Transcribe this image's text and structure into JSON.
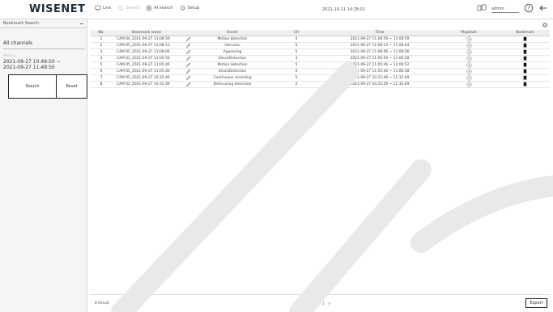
{
  "header": {
    "logo": "WISENET",
    "menu": [
      {
        "label": "Live",
        "icon": "monitor-icon",
        "disabled": false
      },
      {
        "label": "Search",
        "icon": "search-page-icon",
        "disabled": true
      },
      {
        "label": "AI search",
        "icon": "ai-search-icon",
        "disabled": false
      },
      {
        "label": "Setup",
        "icon": "gear-icon",
        "disabled": false
      }
    ],
    "datetime": "2021-10-11 14:28:01",
    "user": "admin"
  },
  "sidebar": {
    "title": "Bookmark Search",
    "channel_value": "All channels",
    "range_caption": "Period",
    "range_from": "2021-09-27 10:49:50 ~",
    "range_to": "2021-09-27 11:49:50",
    "search_label": "Search",
    "reset_label": "Reset"
  },
  "table": {
    "columns": [
      "No.",
      "Bookmark name",
      "",
      "Event",
      "CH",
      "Time",
      "Playback",
      "Bookmark"
    ],
    "rows": [
      {
        "no": "1",
        "name": "CAM 04_2021-09-27 11:08:59",
        "event": "Motion detection",
        "ch": "4",
        "time": "2021-09-27 11:08:59 ~ 11:08:59"
      },
      {
        "no": "2",
        "name": "CAM 05_2021-09-27 11:08:13",
        "event": "Intrusion",
        "ch": "5",
        "time": "2021-09-27 11:08:13 ~ 11:08:44"
      },
      {
        "no": "3",
        "name": "CAM 05_2021-09-27 11:08:06",
        "event": "Appearing",
        "ch": "5",
        "time": "2021-09-27 11:08:06 ~ 11:08:56"
      },
      {
        "no": "4",
        "name": "CAM 03_2021-09-27 11:05:59",
        "event": "ShockDetection",
        "ch": "3",
        "time": "2021-09-27 11:05:59 ~ 11:06:28"
      },
      {
        "no": "5",
        "name": "CAM 05_2021-09-27 11:05:46",
        "event": "Motion detection",
        "ch": "5",
        "time": "2021-09-27 11:05:46 ~ 11:06:52"
      },
      {
        "no": "6",
        "name": "CAM 05_2021-09-27 11:05:40",
        "event": "ShockDetection",
        "ch": "5",
        "time": "2021-09-27 11:05:40 ~ 11:06:38"
      },
      {
        "no": "7",
        "name": "CAM 05_2021-09-27 10:32:49",
        "event": "Continuous recording",
        "ch": "5",
        "time": "2021-09-27 10:32:49 ~ 11:32:49"
      },
      {
        "no": "8",
        "name": "CAM 02_2021-09-27 10:32:49",
        "event": "Defocusing detection",
        "ch": "2",
        "time": "2021-09-27 10:32:49 ~ 11:32:49"
      }
    ]
  },
  "footer": {
    "result": "8 Result",
    "page_prev": "<",
    "page_current": "1",
    "page_total": "/ 1",
    "page_next": ">",
    "export_label": "Export"
  },
  "colors": {
    "logo": "#1c2c3e",
    "bookmark": "#111111",
    "border": "#d8d8d8"
  }
}
